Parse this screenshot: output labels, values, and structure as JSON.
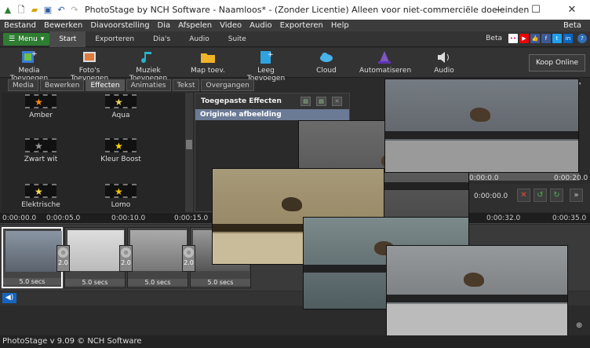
{
  "window": {
    "title": "PhotoStage by NCH Software - Naamloos* - (Zonder Licentie) Alleen voor niet-commerciële doeleinden",
    "min": "—",
    "max": "☐",
    "close": "✕"
  },
  "menu": {
    "items": [
      "Bestand",
      "Bewerken",
      "Diavoorstelling",
      "Dia",
      "Afspelen",
      "Video",
      "Audio",
      "Exporteren",
      "Help"
    ],
    "beta": "Beta"
  },
  "tabs": {
    "menu_button": "Menu",
    "items": [
      "Start",
      "Exporteren",
      "Dia's",
      "Audio",
      "Suite"
    ],
    "beta": "Beta"
  },
  "toolbar": {
    "items": [
      "Media Toevoegen",
      "Foto's Toevoegen",
      "Muziek Toevoegen",
      "Map toev.",
      "Leeg Toevoegen",
      "Cloud",
      "Automatiseren",
      "Audio"
    ],
    "koop": "Koop Online"
  },
  "subtabs": [
    "Media",
    "Bewerken",
    "Effecten",
    "Animaties",
    "Tekst",
    "Overgangen"
  ],
  "effects": [
    "Amber",
    "Aqua",
    "Zwart wit",
    "Kleur Boost",
    "Elektrische",
    "Lomo"
  ],
  "applied": {
    "header": "Toegepaste Effecten",
    "row": "Originele afbeelding"
  },
  "preview": {
    "time_top": "0:00:0.0",
    "time_right": "0:00:20.0",
    "current": "0:00:00.0"
  },
  "ruler": [
    "0:00:00.0",
    "0:00:05.0",
    "0:00:10.0",
    "0:00:15.0",
    "0:00:32.0",
    "0:00:35.0"
  ],
  "clips": [
    {
      "duration": "5.0 secs"
    },
    {
      "duration": "5.0 secs"
    },
    {
      "duration": "5.0 secs"
    },
    {
      "duration": "5.0 secs"
    }
  ],
  "transitions": [
    "2.0",
    "2.0",
    "2.0"
  ],
  "status": "PhotoStage v 9.09 © NCH Software"
}
